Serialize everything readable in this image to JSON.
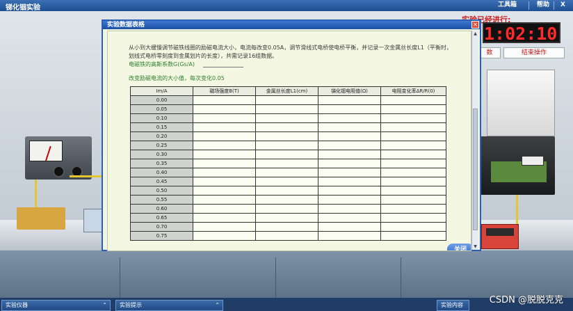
{
  "app": {
    "title": "锑化铟实验"
  },
  "titlebar": {
    "toolbox_label": "工具箱",
    "help_label": "帮助",
    "close_glyph": "X"
  },
  "timer": {
    "label": "实验已经进行:",
    "value": "1:02:10"
  },
  "side_buttons": {
    "left_label": "数",
    "end_label": "结束操作"
  },
  "dialog": {
    "title": "实验数据表格",
    "close_glyph": "×",
    "instructions": "从小到大缓慢调节磁铁线圈的励磁电流大小，电流每改变0.05A，调节滑线式电桥使电桥平衡，并记录一次金属丝长度L1（平衡时，划线式电桥零刻度到金属划片的长度），共需记录16组数据。",
    "high_ratio_label": "电磁铁的高斯系数G(Gs/A)",
    "step_note": "改变励磁电流的大小值，每次变化0.05",
    "close_button": "关闭"
  },
  "table": {
    "headers": [
      "Im/A",
      "磁场强度B(T)",
      "金属丝长度L1(cm)",
      "锑化铟电阻值(Ω)",
      "电阻变化率ΔR/R(0)"
    ],
    "rows": [
      "0.00",
      "0.05",
      "0.10",
      "0.15",
      "0.20",
      "0.25",
      "0.30",
      "0.35",
      "0.40",
      "0.45",
      "0.50",
      "0.55",
      "0.60",
      "0.65",
      "0.70",
      "0.75"
    ]
  },
  "bottom_tabs": [
    "实验仪器",
    "实验提示",
    "实验内容"
  ],
  "watermark": "CSDN @脱脱克克"
}
